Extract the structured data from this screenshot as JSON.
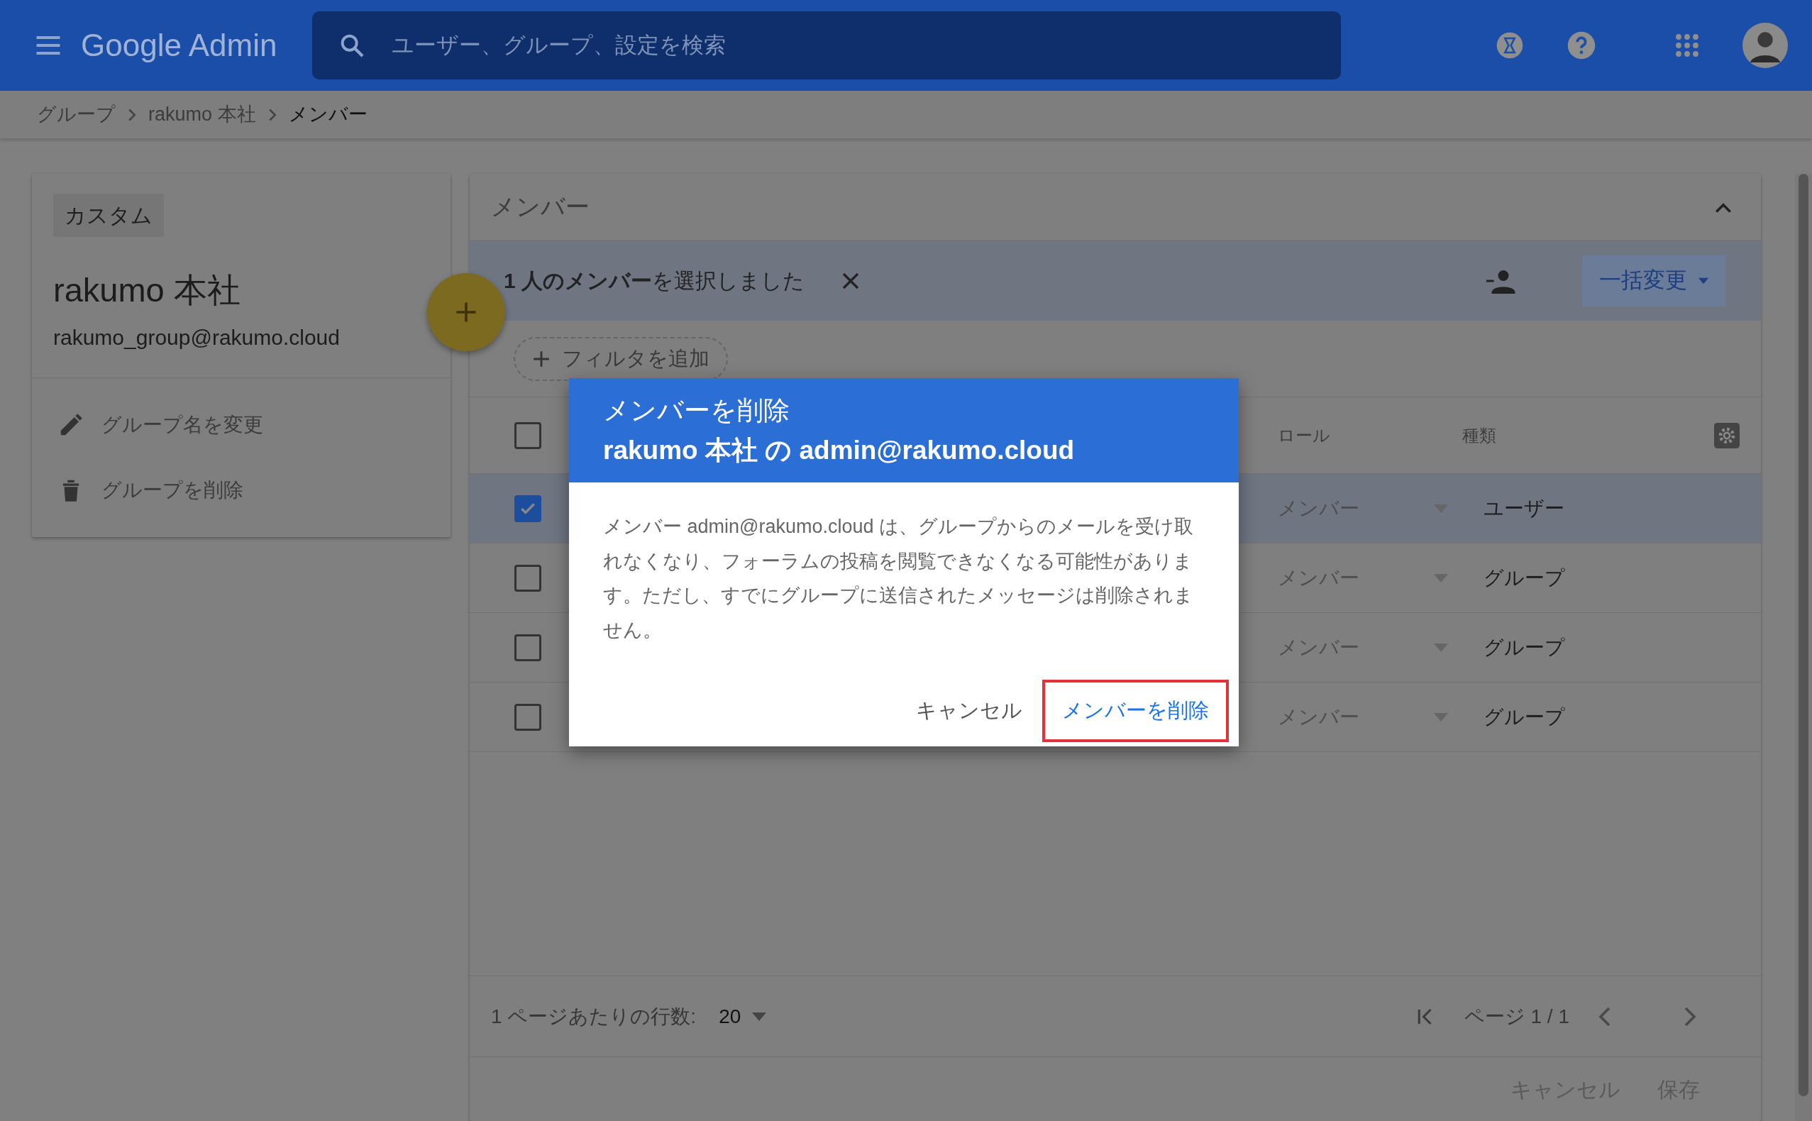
{
  "header": {
    "logo": "Google Admin",
    "search": {
      "placeholder": "ユーザー、グループ、設定を検索"
    }
  },
  "breadcrumb": [
    {
      "label": "グループ",
      "current": false
    },
    {
      "label": "rakumo 本社",
      "current": false
    },
    {
      "label": "メンバー",
      "current": true
    }
  ],
  "group_card": {
    "tag": "カスタム",
    "name": "rakumo 本社",
    "email": "rakumo_group@rakumo.cloud",
    "actions": [
      {
        "label": "グループ名を変更",
        "kind": "rename"
      },
      {
        "label": "グループを削除",
        "kind": "delete"
      }
    ]
  },
  "members": {
    "title": "メンバー",
    "selection_text": "**1 人のメンバー**を選択しました",
    "bulk_button": "一括変更",
    "filter_button": "フィルタを追加",
    "select_all_checked": false,
    "columns": [
      "ロール",
      "種類"
    ],
    "rows": [
      {
        "checked": true,
        "role": "メンバー",
        "type": "ユーザー"
      },
      {
        "checked": false,
        "role": "メンバー",
        "type": "グループ"
      },
      {
        "checked": false,
        "role": "メンバー",
        "type": "グループ"
      },
      {
        "checked": false,
        "role": "メンバー",
        "type": "グループ"
      }
    ],
    "rows_per_page_label": "1 ページあたりの行数:",
    "rows_per_page": "20",
    "page": "ページ 1 / 1",
    "footer_buttons": [
      "キャンセル",
      "保存"
    ]
  },
  "dialog": {
    "title": "メンバーを削除",
    "subtitle": "rakumo 本社 の admin@rakumo.cloud",
    "body": "メンバー admin@rakumo.cloud は、グループからのメールを受け取れなくなり、フォーラムの投稿を閲覧できなくなる可能性があります。ただし、すでにグループに送信されたメッセージは削除されません。",
    "buttons": [
      {
        "label": "キャンセル",
        "kind": "cancel",
        "highlighted": false
      },
      {
        "label": "メンバーを削除",
        "kind": "confirm",
        "highlighted": true
      }
    ]
  }
}
